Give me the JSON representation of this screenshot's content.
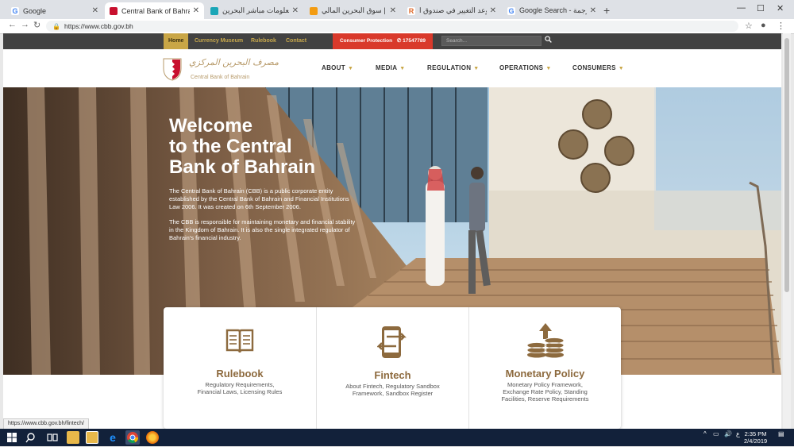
{
  "browser": {
    "tabs": [
      {
        "label": "Google",
        "favicon": "google-icon"
      },
      {
        "label": "Central Bank of Bahrain | CBB",
        "favicon": "cbb-icon"
      },
      {
        "label": "معلومات مباشر البحرين",
        "favicon": "mubasher-icon"
      },
      {
        "label": "أرقام | سوق البحرين المالي",
        "favicon": "argaam-icon"
      },
      {
        "label": "هل حان موعد التغيير في صندوق ا...",
        "favicon": "news-icon"
      },
      {
        "label": "Google Search - ترجمة",
        "favicon": "google-icon"
      }
    ],
    "url": "https://www.cbb.gov.bh",
    "status_url": "https://www.cbb.gov.bh/fintech/"
  },
  "site": {
    "topbar": {
      "home": "Home",
      "links": [
        "Currency Museum",
        "Rulebook",
        "Contact"
      ],
      "consumer": "Consumer Protection",
      "phone": "17547789",
      "search_placeholder": "Search..."
    },
    "logo": {
      "arabic": "مصرف البحرين المركزي",
      "english": "Central Bank of Bahrain"
    },
    "nav": [
      "ABOUT",
      "MEDIA",
      "REGULATION",
      "OPERATIONS",
      "CONSUMERS"
    ],
    "hero": {
      "title_lines": [
        "Welcome",
        "to the Central",
        "Bank of Bahrain"
      ],
      "p1": "The Central Bank of Bahrain (CBB) is a public corporate entity established by the Central Bank of Bahrain and Financial Institutions Law 2006. It was created on 6th September 2006.",
      "p2": "The CBB is responsible for maintaining monetary and financial stability in the Kingdom of Bahrain. It is also the single integrated regulator of Bahrain's financial industry."
    },
    "cards": [
      {
        "title": "Rulebook",
        "desc_lines": [
          "Regulatory Requirements,",
          "Financial Laws, Licensing Rules"
        ],
        "icon": "book-icon"
      },
      {
        "title": "Fintech",
        "desc_lines": [
          "About Fintech, Regulatory Sandbox",
          "Framework, Sandbox Register"
        ],
        "icon": "mobile-transfer-icon"
      },
      {
        "title": "Monetary Policy",
        "desc_lines": [
          "Monetary Policy Framework,",
          "Exchange Rate Policy, Standing",
          "Facilities, Reserve Requirements"
        ],
        "icon": "coins-arrow-icon"
      }
    ]
  },
  "taskbar": {
    "time": "2:35 PM",
    "date": "2/4/2019",
    "lang": "ع"
  },
  "colors": {
    "gold": "#c9a646",
    "brown": "#8d6a3e",
    "red": "#d9392b",
    "dark": "#424242"
  }
}
